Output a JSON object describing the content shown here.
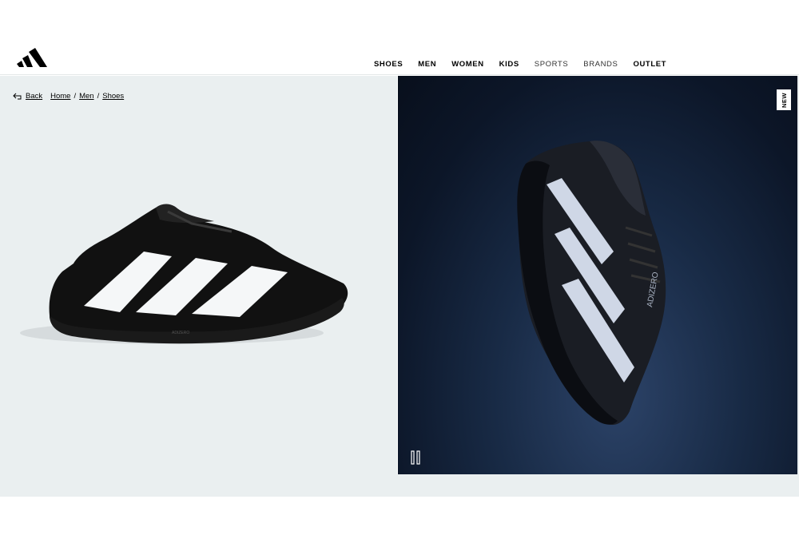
{
  "header": {
    "logo_icon": "adidas-badge-of-sport-icon",
    "nav": [
      {
        "label": "SHOES",
        "style": "bold"
      },
      {
        "label": "MEN",
        "style": "bold"
      },
      {
        "label": "WOMEN",
        "style": "bold"
      },
      {
        "label": "KIDS",
        "style": "bold"
      },
      {
        "label": "SPORTS",
        "style": "light"
      },
      {
        "label": "BRANDS",
        "style": "light"
      },
      {
        "label": "OUTLET",
        "style": "bold"
      }
    ]
  },
  "breadcrumb": {
    "back_label": "Back",
    "items": [
      "Home",
      "Men",
      "Shoes"
    ],
    "separator": "/"
  },
  "gallery": {
    "badge": "NEW",
    "pause_icon": "pause-icon",
    "shoe_text_side": "ADIZERO",
    "colors": {
      "left_bg": "#eaeff0",
      "right_bg": "#0c1628"
    }
  }
}
